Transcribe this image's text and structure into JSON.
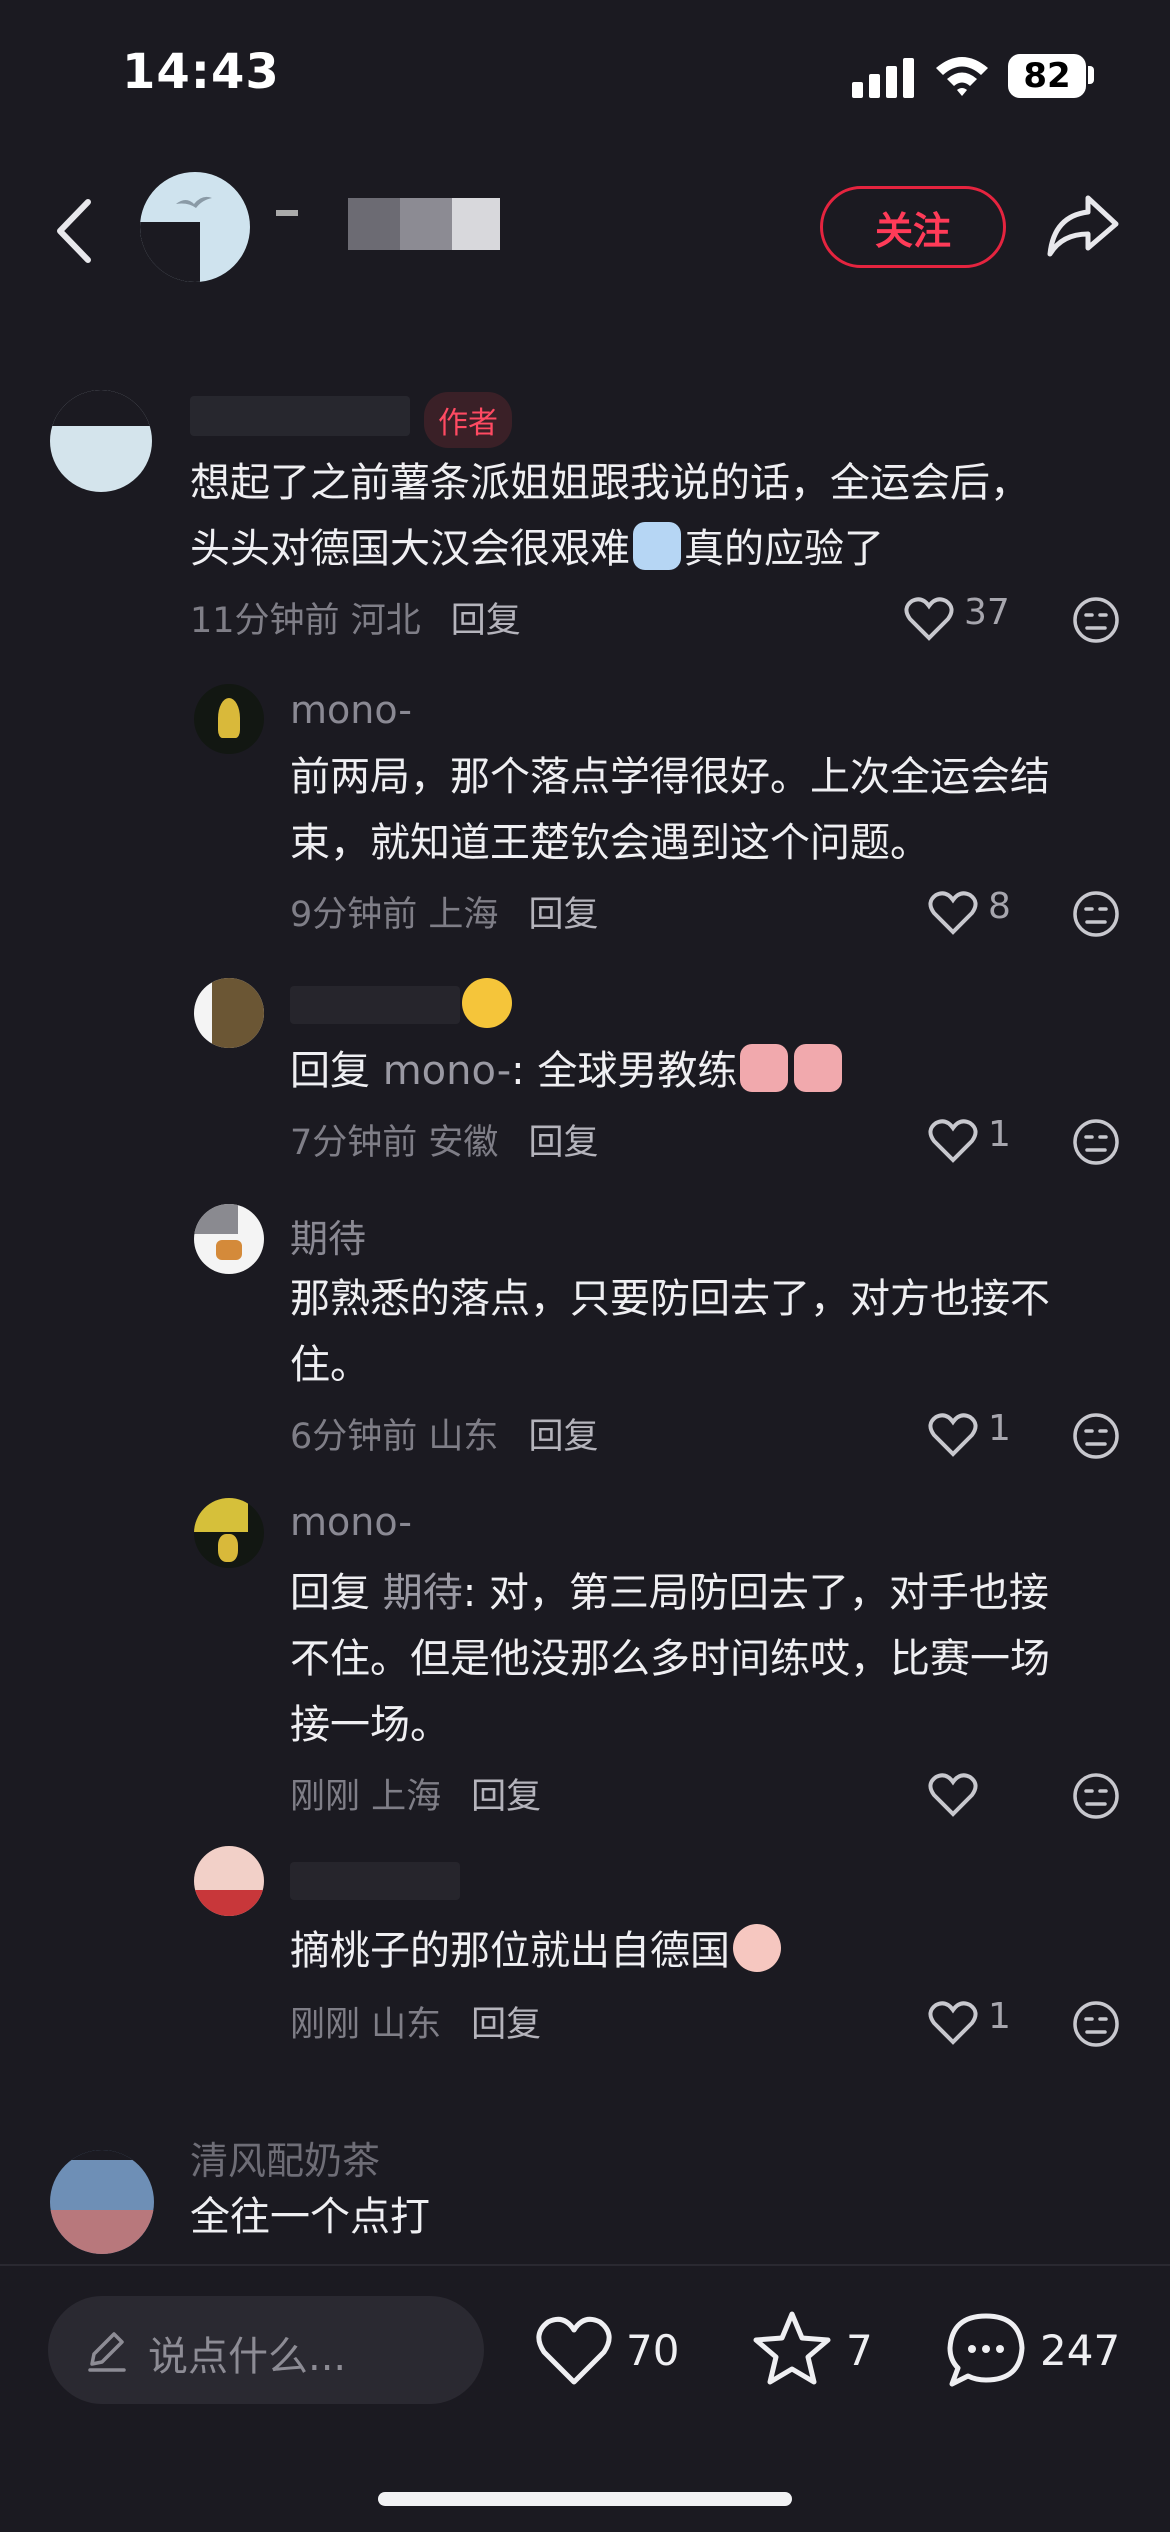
{
  "status_bar": {
    "time": "14:43",
    "battery": "82"
  },
  "header": {
    "follow_label": "关注"
  },
  "comments": [
    {
      "name": "",
      "author_tag": "作者",
      "text_line1": "想起了之前薯条派姐姐跟我说的话，全运会后，",
      "text_line2_before": "头头对德国大汉会很艰难",
      "text_line2_after": "真的应验了",
      "time": "11分钟前",
      "location": "河北",
      "reply_label": "回复",
      "likes": "37"
    },
    {
      "name": "mono-",
      "text_line1": "前两局，那个落点学得很好。上次全运会结",
      "text_line2": "束，就知道王楚钦会遇到这个问题。",
      "time": "9分钟前",
      "location": "上海",
      "reply_label": "回复",
      "likes": "8"
    },
    {
      "name": "",
      "reply_prefix": "回复",
      "mention": "mono-",
      "text": ": 全球男教练",
      "time": "7分钟前",
      "location": "安徽",
      "reply_label": "回复",
      "likes": "1"
    },
    {
      "name": "期待",
      "text_line1": "那熟悉的落点，只要防回去了，对方也接不",
      "text_line2": "住。",
      "time": "6分钟前",
      "location": "山东",
      "reply_label": "回复",
      "likes": "1"
    },
    {
      "name": "mono-",
      "reply_prefix": "回复",
      "mention": "期待",
      "text_line1": ": 对，第三局防回去了，对手也接",
      "text_line2": "不住。但是他没那么多时间练哎，比赛一场",
      "text_line3": "接一场。",
      "time": "刚刚",
      "location": "上海",
      "reply_label": "回复",
      "likes": ""
    },
    {
      "name": "",
      "text": "摘桃子的那位就出自德国",
      "time": "刚刚",
      "location": "山东",
      "reply_label": "回复",
      "likes": "1"
    },
    {
      "name": "清风配奶茶",
      "text": "全往一个点打"
    }
  ],
  "bottom_bar": {
    "input_placeholder": "说点什么...",
    "likes": "70",
    "stars": "7",
    "comments": "247"
  },
  "colors": {
    "accent": "#ff3b58",
    "background": "#1b1a21"
  }
}
